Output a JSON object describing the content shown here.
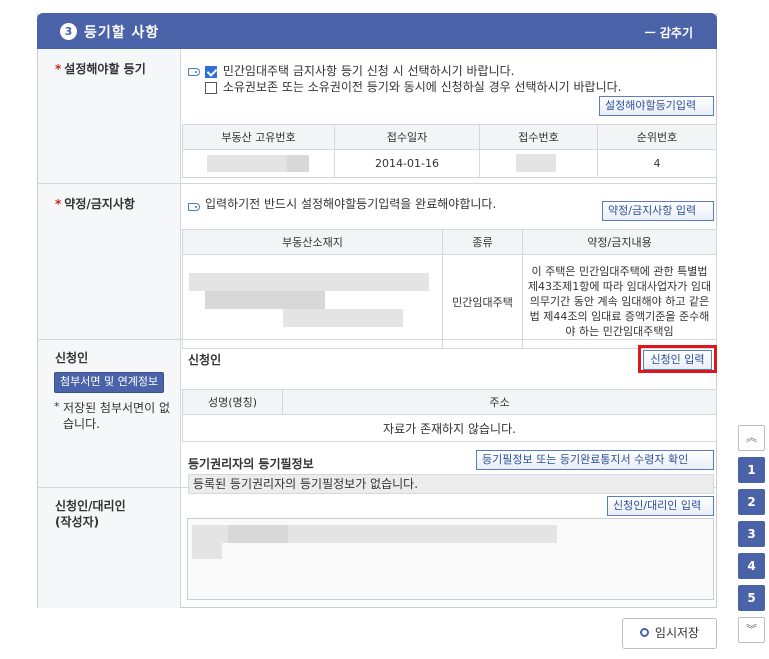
{
  "section": {
    "number": "3",
    "title": "등기할 사항",
    "toggle_label": "ㅡ 감추기"
  },
  "registration": {
    "label": "설정해야할 등기",
    "option1": "민간임대주택 금지사항 등기 신청 시 선택하시기 바랍니다.",
    "option1_checked": true,
    "option2": "소유권보존 또는 소유권이전 등기와 동시에 신청하실 경우 선택하시기 바랍니다.",
    "option2_checked": false,
    "button": "설정해야할등기입력",
    "table_headers": [
      "부동산 고유번호",
      "접수일자",
      "접수번호",
      "순위번호"
    ],
    "table_row": {
      "property_id": "",
      "receipt_date": "2014-01-16",
      "receipt_no": "",
      "rank_no": "4"
    }
  },
  "covenant": {
    "label": "약정/금지사항",
    "notice": "입력하기전 반드시 설정해야할등기입력을 완료해야합니다.",
    "button": "약정/금지사항 입력",
    "table_headers": [
      "부동산소재지",
      "종류",
      "약정/금지내용"
    ],
    "row": {
      "location": "",
      "type": "민간임대주택",
      "content": "이 주택은 민간임대주택에 관한 특별법 제43조제1항에 따라 임대사업자가 임대의무기간 동안 계속 임대해야 하고 같은 법 제44조의 임대료 증액기준을 준수해야 하는 민간임대주택임"
    }
  },
  "applicant": {
    "label": "신청인",
    "attach_button": "첨부서면 및 연계정보",
    "attach_note_bullet": "*",
    "attach_note": "저장된 첨부서면이 없습니다.",
    "sub_title": "신청인",
    "input_button": "신청인 입력",
    "table_headers": [
      "성명(명칭)",
      "주소"
    ],
    "empty_message": "자료가 존재하지 않습니다.",
    "rights_title": "등기권리자의 등기필정보",
    "rights_button": "등기필정보 또는 등기완료통지서 수령자 확인",
    "rights_message": "등록된 등기권리자의 등기필정보가 없습니다."
  },
  "agent": {
    "label": "신청인/대리인 (작성자)",
    "label_line1": "신청인/대리인",
    "label_line2": "(작성자)",
    "button": "신청인/대리인 입력"
  },
  "side_nav": {
    "up": "︽",
    "pages": [
      "1",
      "2",
      "3",
      "4",
      "5"
    ],
    "down": "︾"
  },
  "save_button": "임시저장",
  "colors": {
    "header_bg": "#4a62a8",
    "required_mark": "#d0201c",
    "highlight_border": "#e0161b",
    "button_text": "#2d4f95"
  }
}
